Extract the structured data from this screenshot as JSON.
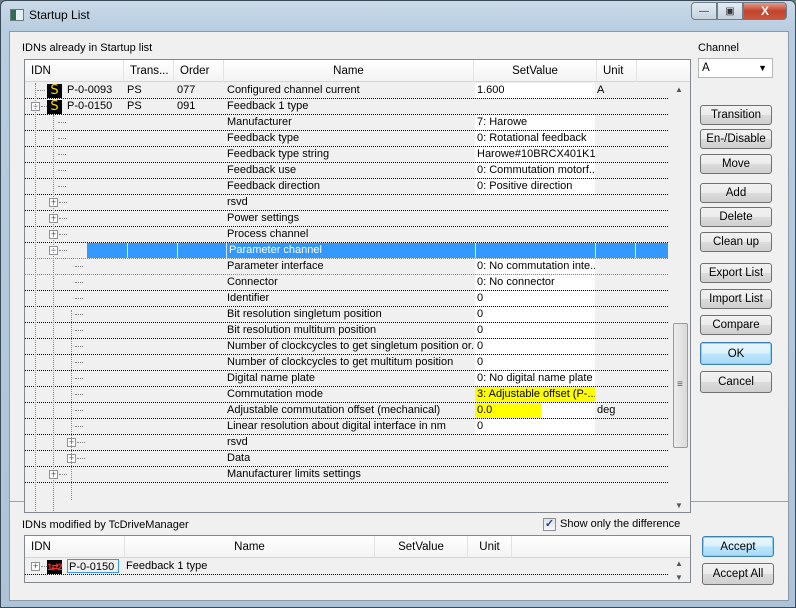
{
  "window": {
    "title": "Startup List",
    "minimize_label": "—",
    "maximize_label": "▣",
    "close_label": "X"
  },
  "startup": {
    "section_label": "IDNs already in Startup list",
    "columns": [
      "IDN",
      "Trans...",
      "Order",
      "Name",
      "SetValue",
      "Unit"
    ],
    "rows": [
      {
        "idn": "P-0-0093",
        "trans": "PS",
        "order": "077",
        "name": "Configured channel current",
        "value": "1.600",
        "unit": "A"
      },
      {
        "idn": "P-0-0150",
        "trans": "PS",
        "order": "091",
        "name": "Feedback 1 type",
        "value": "",
        "unit": ""
      },
      {
        "name": "Manufacturer",
        "value": "7: Harowe"
      },
      {
        "name": "Feedback type",
        "value": "0: Rotational feedback"
      },
      {
        "name": "Feedback type string",
        "value": "Harowe#10BRCX401K1"
      },
      {
        "name": "Feedback use",
        "value": "0: Commutation motorf..."
      },
      {
        "name": "Feedback direction",
        "value": "0: Positive direction"
      },
      {
        "name": "rsvd",
        "value": ""
      },
      {
        "name": "Power settings",
        "value": ""
      },
      {
        "name": "Process channel",
        "value": ""
      },
      {
        "name": "Parameter channel",
        "value": ""
      },
      {
        "name": "Parameter interface",
        "value": "0: No commutation inte..."
      },
      {
        "name": "Connector",
        "value": "0: No connector"
      },
      {
        "name": "Identifier",
        "value": "0"
      },
      {
        "name": "Bit resolution singletum position",
        "value": "0"
      },
      {
        "name": "Bit resolution multitum position",
        "value": "0"
      },
      {
        "name": "Number of clockcycles to get singletum position or...",
        "value": "0"
      },
      {
        "name": "Number of clockcycles to get multitum position",
        "value": "0"
      },
      {
        "name": "Digital name plate",
        "value": "0: No digital name plate"
      },
      {
        "name": "Commutation mode",
        "value": "3: Adjustable offset (P-..."
      },
      {
        "name": "Adjustable commutation offset (mechanical)",
        "value": "0.0",
        "unit": "deg"
      },
      {
        "name": "Linear resolution about digital interface in nm",
        "value": "0"
      },
      {
        "name": "rsvd",
        "value": ""
      },
      {
        "name": "Data",
        "value": ""
      },
      {
        "name": "Manufacturer limits settings",
        "value": ""
      }
    ]
  },
  "channel": {
    "label": "Channel",
    "selected": "A",
    "arrow": "▼"
  },
  "buttons": {
    "transition": "Transition",
    "enable_disable": "En-/Disable",
    "move": "Move",
    "add": "Add",
    "delete": "Delete",
    "clean_up": "Clean up",
    "export_list": "Export List",
    "import_list": "Import List",
    "compare": "Compare",
    "ok": "OK",
    "cancel": "Cancel",
    "accept": "Accept",
    "accept_all": "Accept All"
  },
  "modified": {
    "section_label": "IDNs modified by TcDriveManager",
    "show_diff_label": "Show only the difference",
    "show_diff_checked": true,
    "columns": [
      "IDN",
      "Name",
      "SetValue",
      "Unit"
    ],
    "rows": [
      {
        "idn": "P-0-0150",
        "name": "Feedback 1 type",
        "icon": "1⇄2"
      }
    ]
  },
  "colors": {
    "selection": "#3399ff",
    "highlight": "#ffff00",
    "s_icon_fg": "#ffd800",
    "mod_icon_fg": "#ff2b2b"
  }
}
